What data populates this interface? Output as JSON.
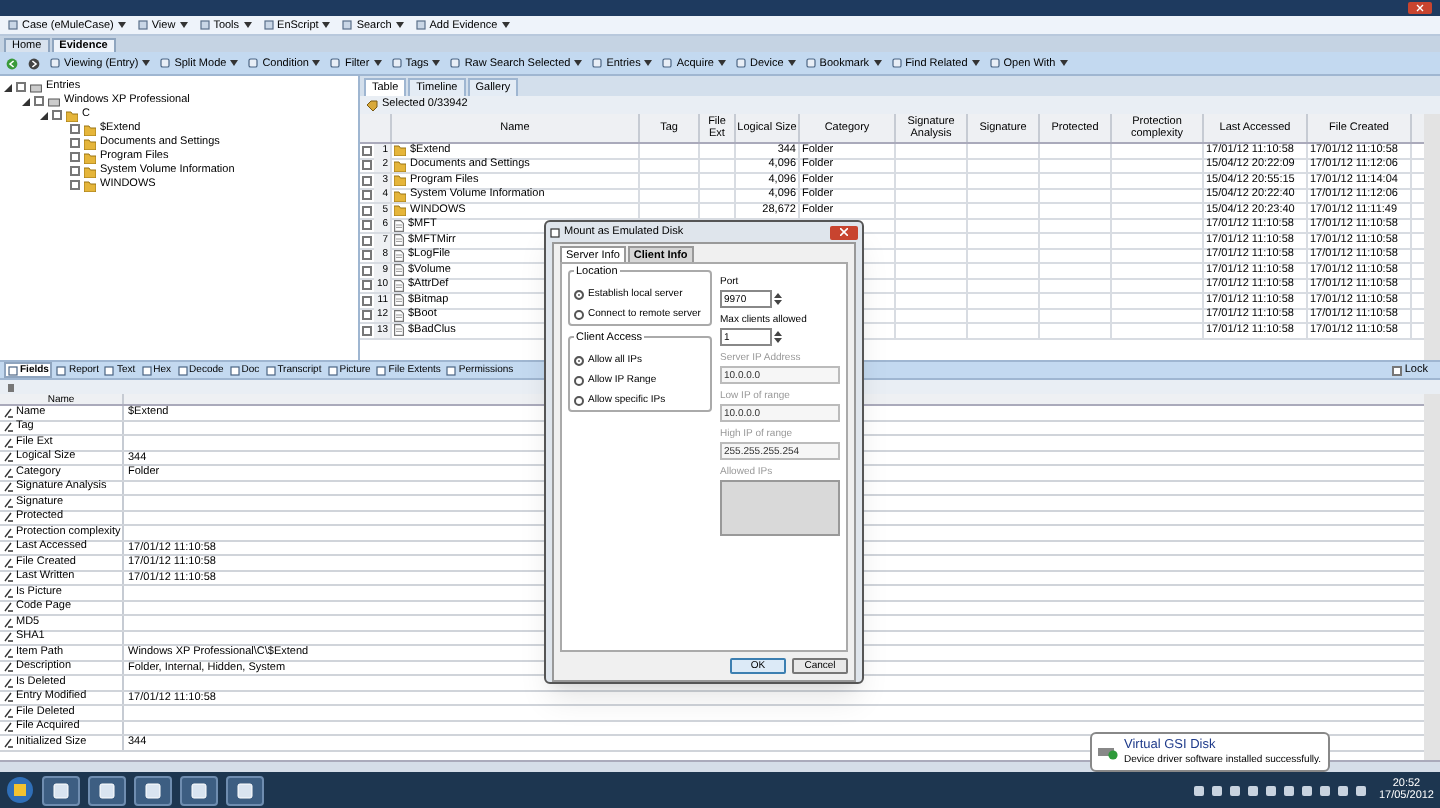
{
  "menu_bar": [
    "Case (eMuleCase)",
    "View",
    "Tools",
    "EnScript",
    "Search",
    "Add Evidence"
  ],
  "main_tabs": [
    {
      "label": "Home",
      "selected": false
    },
    {
      "label": "Evidence",
      "selected": true
    }
  ],
  "toolbar": [
    "Viewing (Entry)",
    "Split Mode",
    "Condition",
    "Filter",
    "Tags",
    "Raw Search Selected",
    "Entries",
    "Acquire",
    "Device",
    "Bookmark",
    "Find Related",
    "Open With"
  ],
  "tree": [
    {
      "label": "Entries",
      "expanded": true,
      "checked": false,
      "children": [
        {
          "label": "Windows XP Professional",
          "expanded": true,
          "checked": false,
          "children": [
            {
              "label": "C",
              "expanded": true,
              "checked": false,
              "children": [
                {
                  "label": "$Extend",
                  "checked": false
                },
                {
                  "label": "Documents and Settings",
                  "checked": false
                },
                {
                  "label": "Program Files",
                  "checked": false
                },
                {
                  "label": "System Volume Information",
                  "checked": false
                },
                {
                  "label": "WINDOWS",
                  "checked": false
                }
              ]
            }
          ]
        }
      ]
    }
  ],
  "view_tabs": [
    {
      "label": "Table",
      "selected": true
    },
    {
      "label": "Timeline",
      "selected": false
    },
    {
      "label": "Gallery",
      "selected": false
    }
  ],
  "selection": "Selected 0/33942",
  "table": {
    "columns": [
      "Name",
      "Tag",
      "File Ext",
      "Logical Size",
      "Category",
      "Signature Analysis",
      "Signature",
      "Protected",
      "Protection complexity",
      "Last Accessed",
      "File Created"
    ],
    "rows": [
      {
        "number": "1",
        "kind": "folder",
        "checked": false,
        "name": "$Extend",
        "logical_size": "344",
        "category": "Folder",
        "last_accessed": "17/01/12 11:10:58",
        "file_created": "17/01/12 11:10:58"
      },
      {
        "number": "2",
        "kind": "folder",
        "checked": false,
        "name": "Documents and Settings",
        "logical_size": "4,096",
        "category": "Folder",
        "last_accessed": "15/04/12 20:22:09",
        "file_created": "17/01/12 11:12:06"
      },
      {
        "number": "3",
        "kind": "folder",
        "checked": false,
        "name": "Program Files",
        "logical_size": "4,096",
        "category": "Folder",
        "last_accessed": "15/04/12 20:55:15",
        "file_created": "17/01/12 11:14:04"
      },
      {
        "number": "4",
        "kind": "folder",
        "checked": false,
        "name": "System Volume Information",
        "logical_size": "4,096",
        "category": "Folder",
        "last_accessed": "15/04/12 20:22:40",
        "file_created": "17/01/12 11:12:06"
      },
      {
        "number": "5",
        "kind": "folder",
        "checked": false,
        "name": "WINDOWS",
        "logical_size": "28,672",
        "category": "Folder",
        "last_accessed": "15/04/12 20:23:40",
        "file_created": "17/01/12 11:11:49"
      },
      {
        "number": "6",
        "kind": "file",
        "checked": false,
        "name": "$MFT",
        "last_accessed": "17/01/12 11:10:58",
        "file_created": "17/01/12 11:10:58"
      },
      {
        "number": "7",
        "kind": "file",
        "checked": false,
        "name": "$MFTMirr",
        "last_accessed": "17/01/12 11:10:58",
        "file_created": "17/01/12 11:10:58"
      },
      {
        "number": "8",
        "kind": "file",
        "checked": false,
        "name": "$LogFile",
        "last_accessed": "17/01/12 11:10:58",
        "file_created": "17/01/12 11:10:58"
      },
      {
        "number": "9",
        "kind": "file",
        "checked": false,
        "name": "$Volume",
        "last_accessed": "17/01/12 11:10:58",
        "file_created": "17/01/12 11:10:58"
      },
      {
        "number": "10",
        "kind": "file",
        "checked": false,
        "name": "$AttrDef",
        "last_accessed": "17/01/12 11:10:58",
        "file_created": "17/01/12 11:10:58"
      },
      {
        "number": "11",
        "kind": "file",
        "checked": false,
        "name": "$Bitmap",
        "last_accessed": "17/01/12 11:10:58",
        "file_created": "17/01/12 11:10:58"
      },
      {
        "number": "12",
        "kind": "file",
        "checked": false,
        "name": "$Boot",
        "last_accessed": "17/01/12 11:10:58",
        "file_created": "17/01/12 11:10:58"
      },
      {
        "number": "13",
        "kind": "file",
        "checked": false,
        "name": "$BadClus",
        "last_accessed": "17/01/12 11:10:58",
        "file_created": "17/01/12 11:10:58"
      }
    ]
  },
  "detail_tabs": [
    {
      "label": "Fields",
      "selected": true
    },
    {
      "label": "Report",
      "selected": false
    },
    {
      "label": "Text",
      "selected": false
    },
    {
      "label": "Hex",
      "selected": false
    },
    {
      "label": "Decode",
      "selected": false
    },
    {
      "label": "Doc",
      "selected": false
    },
    {
      "label": "Transcript",
      "selected": false
    },
    {
      "label": "Picture",
      "selected": false
    },
    {
      "label": "File Extents",
      "selected": false
    },
    {
      "label": "Permissions",
      "selected": false
    }
  ],
  "lock": {
    "label": "Lock",
    "checked": false
  },
  "fields": {
    "header": "Name",
    "rows": [
      {
        "name": "Name",
        "value": "$Extend"
      },
      {
        "name": "Tag"
      },
      {
        "name": "File Ext"
      },
      {
        "name": "Logical Size",
        "value": "344"
      },
      {
        "name": "Category",
        "value": "Folder"
      },
      {
        "name": "Signature Analysis"
      },
      {
        "name": "Signature"
      },
      {
        "name": "Protected"
      },
      {
        "name": "Protection complexity"
      },
      {
        "name": "Last Accessed",
        "value": "17/01/12 11:10:58"
      },
      {
        "name": "File Created",
        "value": "17/01/12 11:10:58"
      },
      {
        "name": "Last Written",
        "value": "17/01/12 11:10:58"
      },
      {
        "name": "Is Picture"
      },
      {
        "name": "Code Page"
      },
      {
        "name": "MD5"
      },
      {
        "name": "SHA1"
      },
      {
        "name": "Item Path",
        "value": "Windows XP Professional\\C\\$Extend"
      },
      {
        "name": "Description",
        "value": "Folder, Internal, Hidden, System"
      },
      {
        "name": "Is Deleted"
      },
      {
        "name": "Entry Modified",
        "value": "17/01/12 11:10:58"
      },
      {
        "name": "File Deleted"
      },
      {
        "name": "File Acquired"
      },
      {
        "name": "Initialized Size",
        "value": "344"
      }
    ]
  },
  "dialog": {
    "title": "Mount as Emulated Disk",
    "tabs": [
      {
        "label": "Server Info",
        "selected": true
      },
      {
        "label": "Client Info",
        "selected": false
      }
    ],
    "location": {
      "title": "Location",
      "options": [
        {
          "label": "Establish local server",
          "selected": true
        },
        {
          "label": "Connect to remote server",
          "selected": false
        }
      ]
    },
    "client_access": {
      "title": "Client Access",
      "options": [
        {
          "label": "Allow all IPs",
          "selected": true
        },
        {
          "label": "Allow IP Range",
          "selected": false
        },
        {
          "label": "Allow specific IPs",
          "selected": false
        }
      ]
    },
    "port": {
      "label": "Port",
      "value": "9970"
    },
    "max_clients": {
      "label": "Max clients allowed",
      "value": "1"
    },
    "fields": [
      {
        "label": "Server IP Address",
        "value": "10.0.0.0",
        "disabled": true
      },
      {
        "label": "Low IP of range",
        "value": "10.0.0.0",
        "disabled": true
      },
      {
        "label": "High IP of range",
        "value": "255.255.255.254",
        "disabled": true
      }
    ],
    "allowed_ips": {
      "label": "Allowed IPs",
      "disabled": true
    },
    "buttons": [
      "OK",
      "Cancel"
    ]
  },
  "notification": {
    "title": "Virtual GSI Disk",
    "message": "Device driver software installed successfully."
  },
  "clock": {
    "time": "20:52",
    "date": "17/05/2012"
  }
}
